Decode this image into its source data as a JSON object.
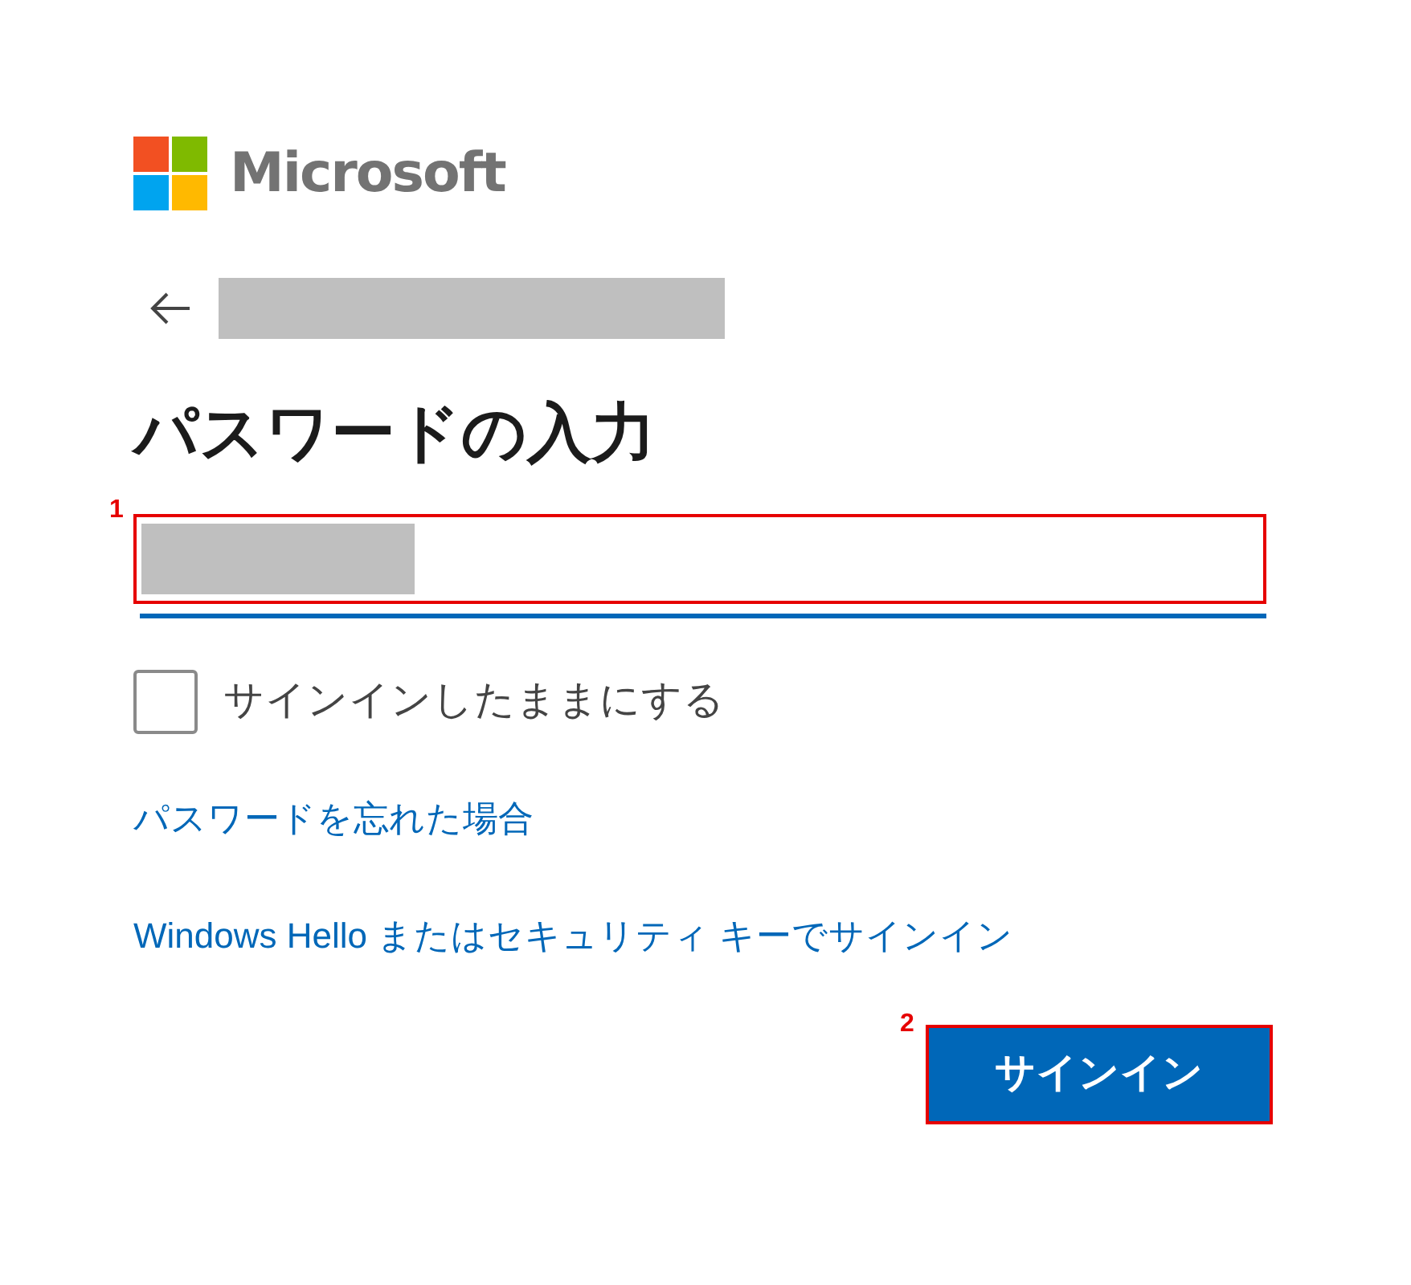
{
  "logo": {
    "text": "Microsoft"
  },
  "back": {
    "redacted": true
  },
  "heading": "パスワードの入力",
  "password_field": {
    "redacted": true,
    "annotation": "1"
  },
  "keep_signed_in": {
    "label": "サインインしたままにする",
    "checked": false
  },
  "links": [
    "パスワードを忘れた場合",
    "Windows Hello またはセキュリティ キーでサインイン"
  ],
  "sign_in_button": {
    "label": "サインイン",
    "annotation": "2"
  }
}
